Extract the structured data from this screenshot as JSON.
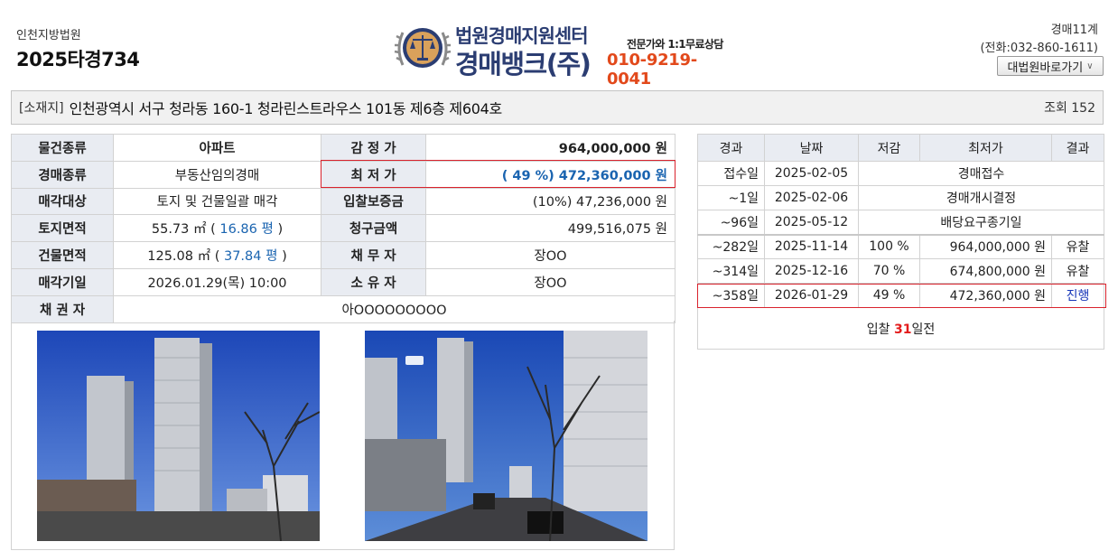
{
  "header": {
    "court": "인천지방법원",
    "case_number": "2025타경734",
    "department": "경매11계",
    "phone": "(전화:032-860-1611)",
    "court_link_label": "대법원바로가기"
  },
  "logo": {
    "title_line1": "법원경매지원센터",
    "title_line2": "경매뱅크(주)",
    "consult_text": "전문가와 1:1무료상담",
    "phone": "010-9219-0041",
    "emblem_icon": "court-scales-emblem-icon"
  },
  "location": {
    "label": "[소재지]",
    "address": "인천광역시 서구 청라동 160-1 청라린스트라우스 101동 제6층 제604호",
    "views": "조회 152"
  },
  "info": {
    "item_type_label": "물건종류",
    "item_type": "아파트",
    "appraisal_label": "감 정 가",
    "appraisal": "964,000,000 원",
    "auction_type_label": "경매종류",
    "auction_type": "부동산임의경매",
    "min_price_label": "최 저 가",
    "min_price": "( 49 %) 472,360,000 원",
    "sale_target_label": "매각대상",
    "sale_target": "토지 및 건물일괄 매각",
    "deposit_label": "입찰보증금",
    "deposit": "(10%) 47,236,000 원",
    "land_area_label": "토지면적",
    "land_area_m2": "55.73 ㎡ ( ",
    "land_area_py": "16.86 평",
    "land_area_close": ")",
    "claim_label": "청구금액",
    "claim": "499,516,075 원",
    "building_area_label": "건물면적",
    "building_area_m2": "125.08 ㎡ ( ",
    "building_area_py": "37.84 평",
    "building_area_close": ")",
    "debtor_label": "채 무 자",
    "debtor": "장OO",
    "sale_date_label": "매각기일",
    "sale_date": "2026.01.29(목) 10:00",
    "owner_label": "소 유 자",
    "owner": "장OO",
    "creditor_label": "채 권 자",
    "creditor": "아OOOOOOOOO"
  },
  "history": {
    "headers": [
      "경과",
      "날짜",
      "저감",
      "최저가",
      "결과"
    ],
    "events": [
      {
        "elapsed": "접수일",
        "date": "2025-02-05",
        "event": "경매접수"
      },
      {
        "elapsed": "~1일",
        "date": "2025-02-06",
        "event": "경매개시결정"
      },
      {
        "elapsed": "~96일",
        "date": "2025-05-12",
        "event": "배당요구종기일"
      }
    ],
    "rounds": [
      {
        "elapsed": "~282일",
        "date": "2025-11-14",
        "rate": "100 %",
        "price": "964,000,000 원",
        "result": "유찰"
      },
      {
        "elapsed": "~314일",
        "date": "2025-12-16",
        "rate": "70 %",
        "price": "674,800,000 원",
        "result": "유찰"
      },
      {
        "elapsed": "~358일",
        "date": "2026-01-29",
        "rate": "49 %",
        "price": "472,360,000 원",
        "result": "진행"
      }
    ],
    "footer_prefix": "입찰 ",
    "footer_days": "31",
    "footer_suffix": "일전"
  },
  "colors": {
    "accent_blue": "#1a64b0",
    "highlight_red": "#d9232d",
    "logo_navy": "#2b3d72",
    "logo_orange": "#e2491b",
    "label_bg": "#e9ecf2"
  }
}
